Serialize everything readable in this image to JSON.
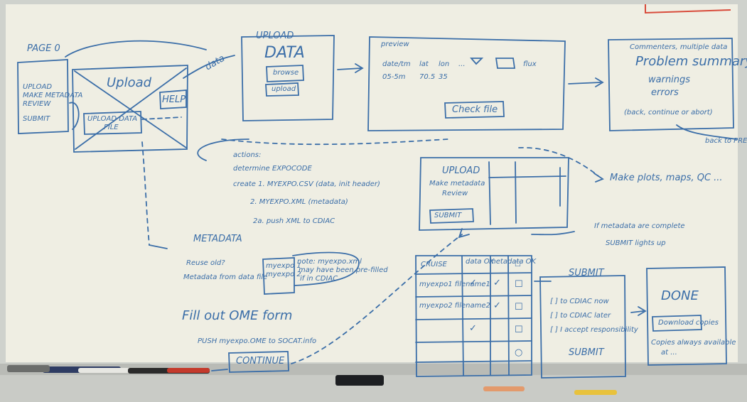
{
  "page": {
    "label": "PAGE 0",
    "steps": [
      "UPLOAD",
      "MAKE METADATA",
      "REVIEW",
      "SUBMIT"
    ]
  },
  "sketch1": {
    "title": "Upload",
    "help": "HELP",
    "upload_data_file": [
      "UPLOAD DATA",
      "FILE"
    ],
    "arrow_label": "data"
  },
  "upload_screen": {
    "title": "UPLOAD",
    "subtitle": "DATA",
    "browse": "browse",
    "upload": "upload"
  },
  "preview": {
    "tag": "preview",
    "row1": [
      "date/tm",
      "lat",
      "lon",
      "...",
      "flux"
    ],
    "row2": [
      "05-5m",
      "70.5",
      "35"
    ],
    "check": "Check file"
  },
  "problems": {
    "line1": "Commenters, multiple data",
    "line2": "Problem summary",
    "line3": "warnings",
    "line4": "errors",
    "line5": "(back, continue or abort)",
    "back": "back to PREV"
  },
  "actions": {
    "lines": [
      "actions:",
      "determine EXPOCODE",
      "create 1. MYEXPO.CSV (data, init header)",
      "2. MYEXPO.XML (metadata)",
      "2a. push XML to CDIAC"
    ]
  },
  "metadata_panel": {
    "title": "UPLOAD",
    "subtitle": "Make metadata",
    "review": "Review",
    "submit": "SUBMIT"
  },
  "qc": {
    "text": "Make plots, maps, QC ..."
  },
  "metadata": {
    "title": "METADATA",
    "reuse": "Reuse old?",
    "from_file": "Metadata from data file",
    "list": [
      "myexpo 1",
      "myexpo 2"
    ],
    "note": [
      "note: myexpo.xml",
      "may have been pre-filled",
      "if in CDIAC"
    ]
  },
  "ome": {
    "fill": "Fill out OME form",
    "push": "PUSH myexpo.OME to SOCAT.info",
    "continue": "CONTINUE"
  },
  "review_table": {
    "headers": [
      "CRUISE",
      "data OK",
      "metadata OK",
      "☐"
    ],
    "rows": [
      [
        "myexpo1 filename1",
        "✓",
        "✓",
        "☐"
      ],
      [
        "myexpo2 filename2",
        "",
        "✓",
        "☐"
      ],
      [
        "",
        "✓",
        "",
        "☐"
      ],
      [
        "",
        "",
        "",
        "○"
      ],
      [
        "",
        "",
        "",
        ""
      ]
    ]
  },
  "complete_note": [
    "If metadata are complete",
    "SUBMIT lights up"
  ],
  "submit_panel": {
    "title": "SUBMIT",
    "opt1": "[ ] to CDIAC now",
    "opt2": "[ ] to CDIAC later",
    "opt3": "[ ] I accept responsibility",
    "button": "SUBMIT"
  },
  "done": {
    "title": "DONE",
    "download": "Download copies",
    "note": [
      "Copies always available",
      "at ..."
    ]
  },
  "colors": {
    "board": "#efeee3",
    "marker": "#3b6ea8",
    "red_marker": "#d84a3a"
  }
}
